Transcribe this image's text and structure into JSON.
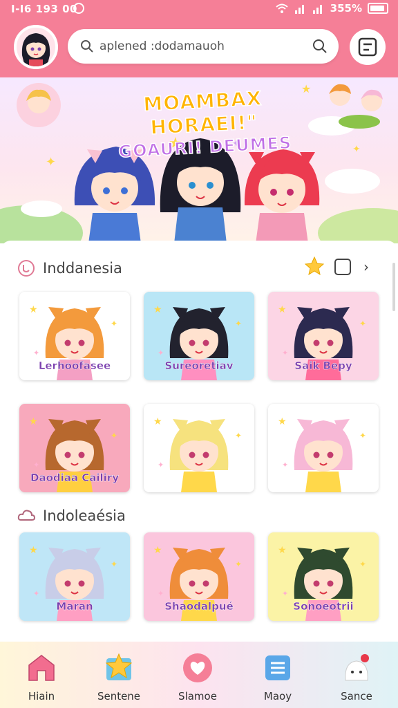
{
  "status": {
    "time": "I-I6 193 00",
    "battery": "355%"
  },
  "search": {
    "value": "aplened :dodamauoh",
    "placeholder": "aplened :dodamauoh"
  },
  "banner": {
    "line1": "MOAMBAX HORAEI!\"",
    "line2": "GOAURI! DEUMES"
  },
  "sections": [
    {
      "title": "Inddanesia",
      "cards": [
        {
          "label": "Lerhoofasee",
          "bg": "#ffffff",
          "hair": "#f39a3c",
          "accent": "#f4a0c4"
        },
        {
          "label": "Sureoretiav",
          "bg": "#b9e6f6",
          "hair": "#22222e",
          "accent": "#ff8fc0"
        },
        {
          "label": "Saik Bepy",
          "bg": "#fcd5e5",
          "hair": "#2c2a50",
          "accent": "#ff6c9a"
        },
        {
          "label": "Daodiaa Cailiry",
          "bg": "#f8a9bc",
          "hair": "#b7682e",
          "accent": "#ffcf40"
        },
        {
          "label": "",
          "bg": "#ffffff",
          "hair": "#f6e27e",
          "accent": "#ffd84a"
        },
        {
          "label": "",
          "bg": "#ffffff",
          "hair": "#f7b8d6",
          "accent": "#ffd84a"
        }
      ]
    },
    {
      "title": "Indoleaésia",
      "cards": [
        {
          "label": "Maran",
          "bg": "#bfe6f7",
          "hair": "#c8cde8",
          "accent": "#ff9fc3"
        },
        {
          "label": "Shaodalpué",
          "bg": "#fbc6dd",
          "hair": "#ef8d3a",
          "accent": "#ffd84a"
        },
        {
          "label": "Sonoeotrii",
          "bg": "#fbf3a6",
          "hair": "#2f4a2f",
          "accent": "#ff9fc3"
        }
      ]
    }
  ],
  "nav": [
    {
      "label": "Hiain",
      "icon": "home-icon",
      "color": "#f26d8f"
    },
    {
      "label": "Sentene",
      "icon": "star-icon",
      "color": "#ffc93c"
    },
    {
      "label": "Slamoe",
      "icon": "heart-icon",
      "color": "#f57f97"
    },
    {
      "label": "Maoy",
      "icon": "list-icon",
      "color": "#5aa7e8"
    },
    {
      "label": "Sance",
      "icon": "mascot-icon",
      "color": "#ffffff"
    }
  ],
  "colors": {
    "header": "#f57f97",
    "label": "#7a3fae"
  }
}
